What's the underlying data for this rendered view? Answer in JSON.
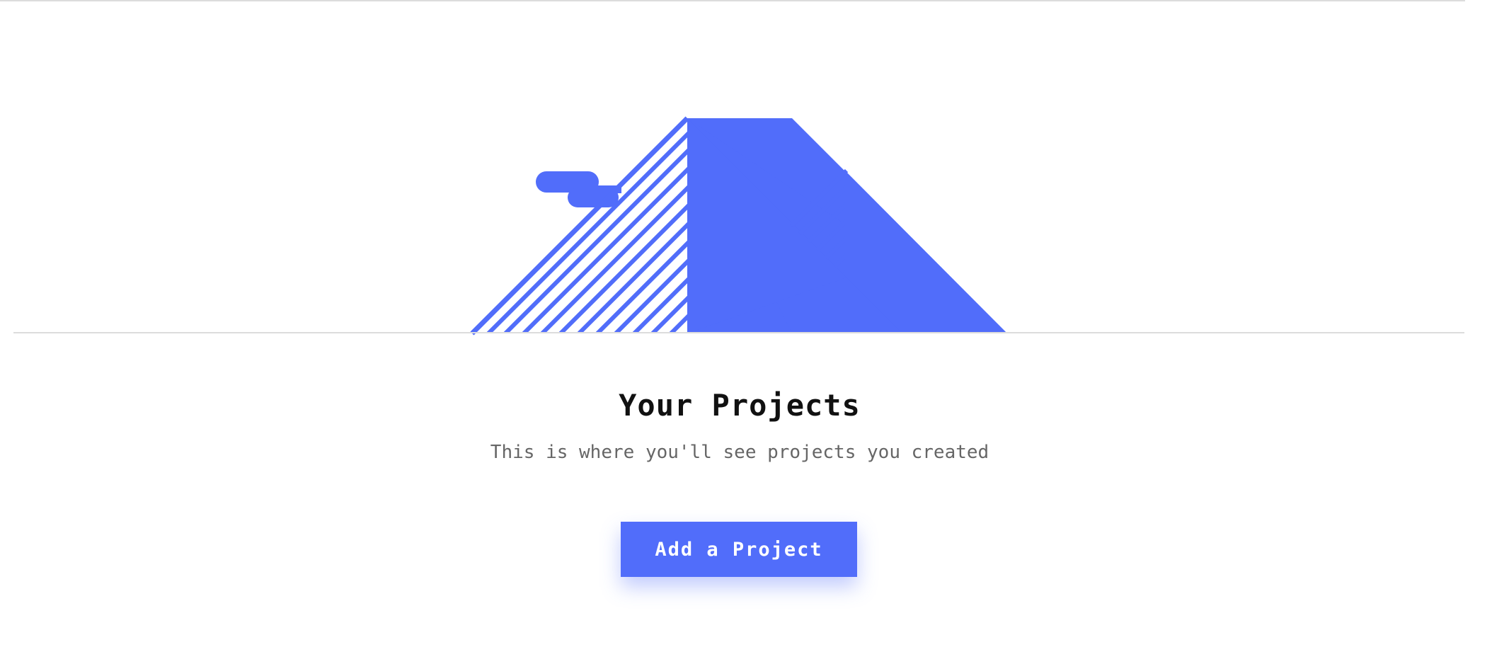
{
  "empty_state": {
    "title": "Your Projects",
    "subtitle": "This is where you'll see projects you created",
    "add_button_label": "Add a Project",
    "illustration_icon": "mountains-icon"
  },
  "colors": {
    "accent": "#516dfa",
    "divider": "#dcdcdc",
    "title_text": "#111111",
    "subtitle_text": "#666666"
  }
}
